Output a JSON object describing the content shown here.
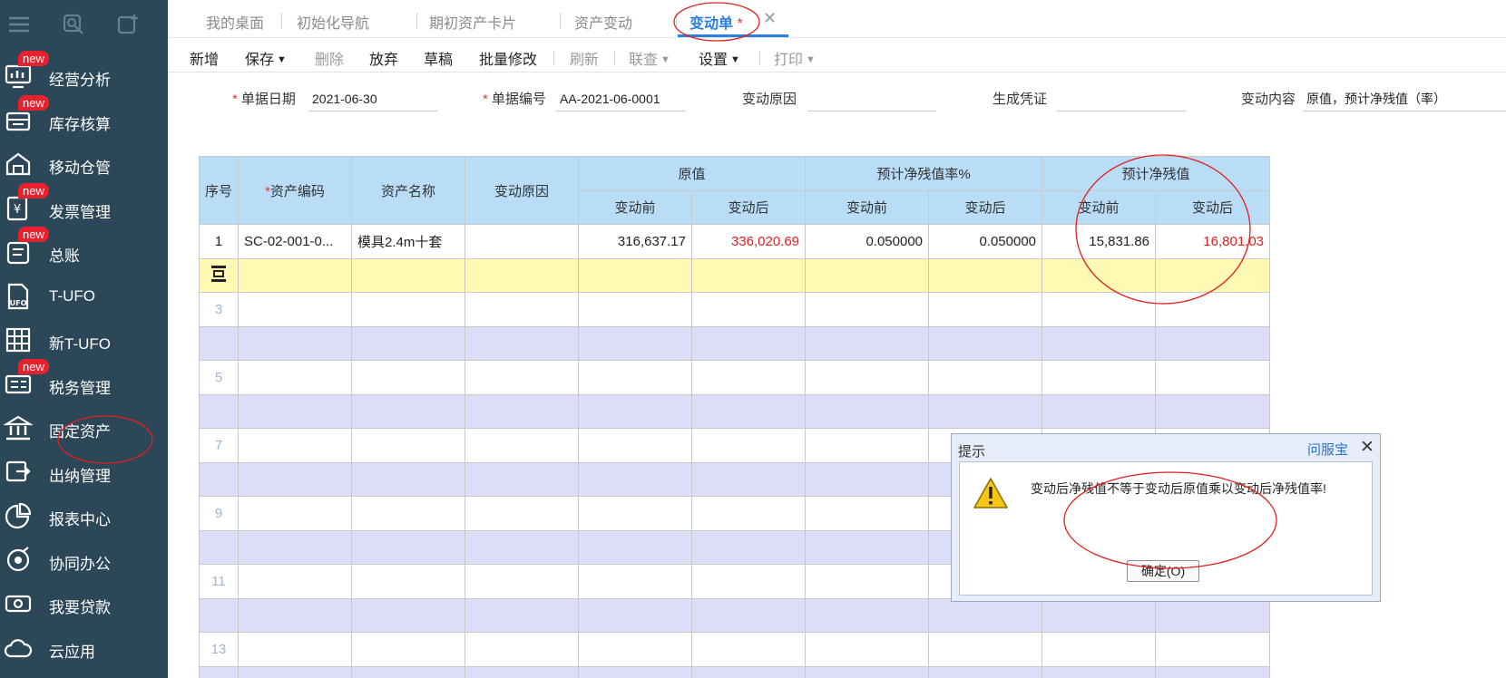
{
  "tabs": [
    "我的桌面",
    "初始化导航",
    "期初资产卡片",
    "资产变动",
    "变动单"
  ],
  "active_tab_marker": "*",
  "toolbar": {
    "items": [
      "新增",
      "保存",
      "删除",
      "放弃",
      "草稿",
      "批量修改",
      "刷新",
      "联查",
      "设置",
      "打印"
    ]
  },
  "sidebar": {
    "badge": "new",
    "items": [
      {
        "label": "经营分析",
        "icon": "chart-screen-icon",
        "new": true
      },
      {
        "label": "库存核算",
        "icon": "stock-box-icon",
        "new": true
      },
      {
        "label": "移动仓管",
        "icon": "warehouse-icon",
        "new": false
      },
      {
        "label": "发票管理",
        "icon": "invoice-icon",
        "new": true
      },
      {
        "label": "总账",
        "icon": "ledger-icon",
        "new": true
      },
      {
        "label": "T-UFO",
        "icon": "ufo-doc-icon",
        "new": false
      },
      {
        "label": "新T-UFO",
        "icon": "ufo-table-icon",
        "new": false
      },
      {
        "label": "税务管理",
        "icon": "tax-icon",
        "new": true
      },
      {
        "label": "固定资产",
        "icon": "bank-building-icon",
        "new": false
      },
      {
        "label": "出纳管理",
        "icon": "cashier-icon",
        "new": false
      },
      {
        "label": "报表中心",
        "icon": "pie-chart-icon",
        "new": false
      },
      {
        "label": "协同办公",
        "icon": "collaboration-icon",
        "new": false
      },
      {
        "label": "我要贷款",
        "icon": "money-icon",
        "new": false
      },
      {
        "label": "云应用",
        "icon": "cloud-icon",
        "new": false
      }
    ]
  },
  "form": {
    "date_label": "单据日期",
    "date_value": "2021-06-30",
    "docno_label": "单据编号",
    "docno_value": "AA-2021-06-0001",
    "reason_label": "变动原因",
    "reason_value": "",
    "voucher_label": "生成凭证",
    "voucher_value": "",
    "content_label": "变动内容",
    "content_value": "原值，预计净残值（率）"
  },
  "grid": {
    "headers": {
      "seq": "序号",
      "code": "资产编码",
      "name": "资产名称",
      "reason": "变动原因",
      "orig": "原值",
      "rate": "预计净残值率%",
      "residual": "预计净残值",
      "before": "变动前",
      "after": "变动后"
    },
    "row1": {
      "seq": "1",
      "code": "SC-02-001-0...",
      "name": "模具2.4m十套",
      "reason": "",
      "orig_before": "316,637.17",
      "orig_after": "336,020.69",
      "rate_before": "0.050000",
      "rate_after": "0.050000",
      "res_before": "15,831.86",
      "res_after": "16,801.03"
    },
    "row_numbers": [
      "3",
      "5",
      "7",
      "9",
      "11",
      "13"
    ]
  },
  "dialog": {
    "title": "提示",
    "help": "问服宝",
    "message": "变动后净残值不等于变动后原值乘以变动后净残值率!",
    "ok_label": "确定(O)"
  }
}
